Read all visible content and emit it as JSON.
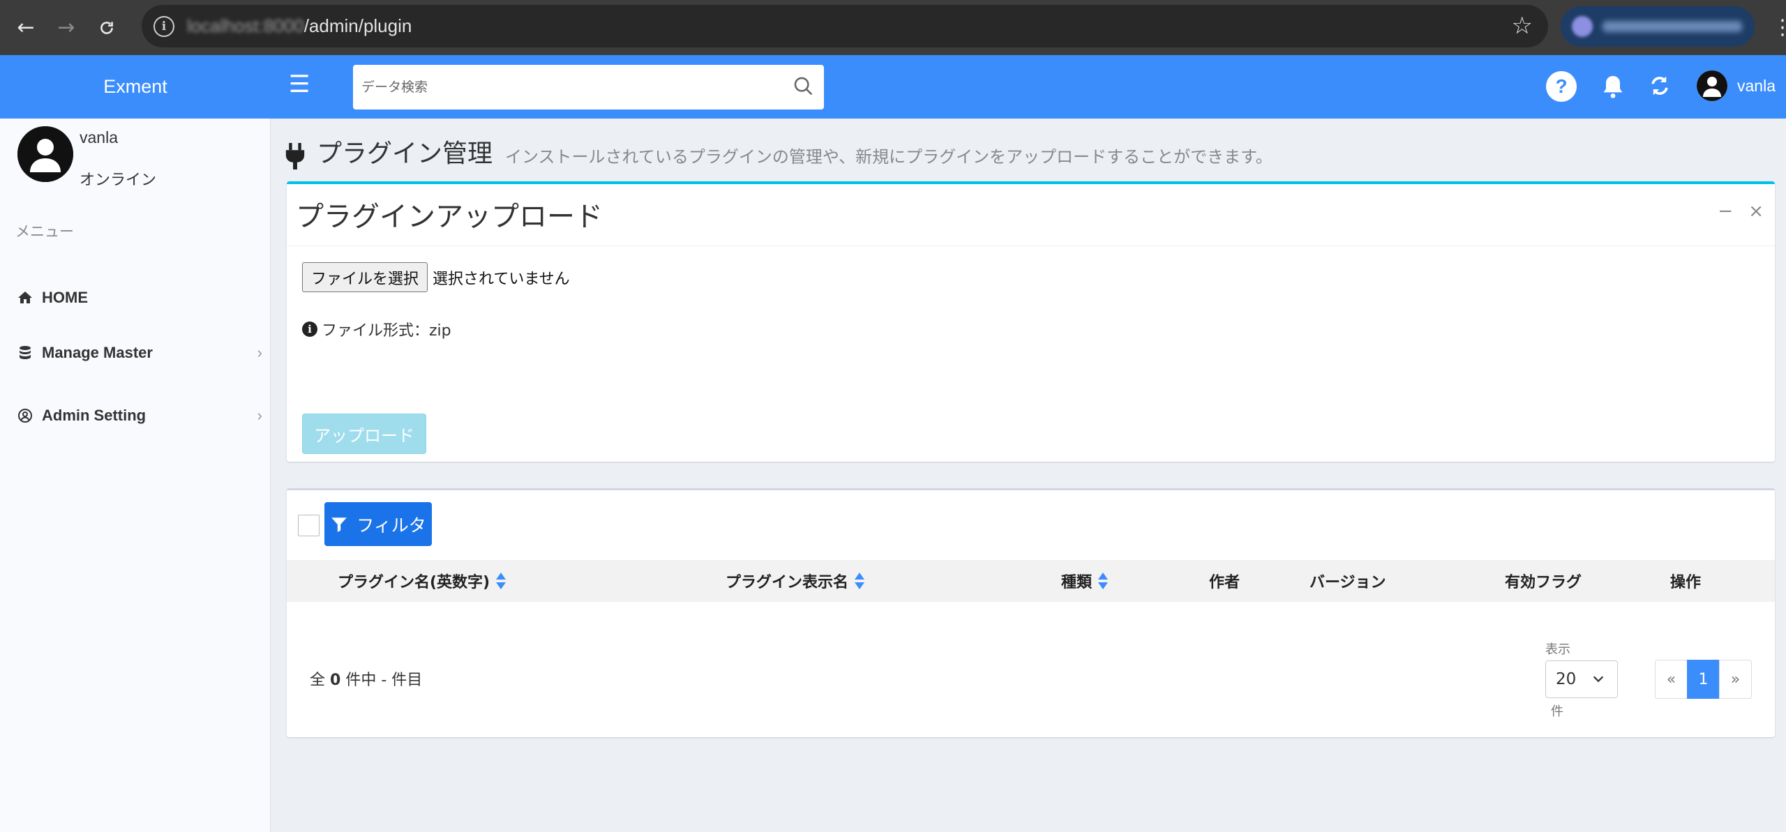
{
  "browser": {
    "url_host": "localhost:8000",
    "url_path": "/admin/plugin"
  },
  "header": {
    "logo": "Exment",
    "search_placeholder": "データ検索",
    "help_label": "?",
    "user_name": "vanla"
  },
  "sidebar": {
    "user_name": "vanla",
    "status": "オンライン",
    "menu_header": "メニュー",
    "items": [
      {
        "label": "HOME",
        "icon": "home-icon"
      },
      {
        "label": "Manage Master",
        "icon": "database-icon",
        "has_children": true
      },
      {
        "label": "Admin Setting",
        "icon": "user-circle-icon",
        "has_children": true
      }
    ]
  },
  "page": {
    "title": "プラグイン管理",
    "description": "インストールされているプラグインの管理や、新規にプラグインをアップロードすることができます。"
  },
  "upload_box": {
    "title": "プラグインアップロード",
    "file_button": "ファイルを選択",
    "file_status": "選択されていません",
    "file_help": "ファイル形式：zip",
    "upload_button": "アップロード"
  },
  "list": {
    "filter_button": "フィルタ",
    "columns": [
      {
        "label": "プラグイン名(英数字)",
        "sortable": true
      },
      {
        "label": "プラグイン表示名",
        "sortable": true
      },
      {
        "label": "種類",
        "sortable": true
      },
      {
        "label": "作者",
        "sortable": false
      },
      {
        "label": "バージョン",
        "sortable": false
      },
      {
        "label": "有効フラグ",
        "sortable": false
      },
      {
        "label": "操作",
        "sortable": false
      }
    ],
    "total_prefix": "全",
    "total_count": "0",
    "total_suffix": "件中 - 件目",
    "per_page_label": "表示",
    "per_page_value": "20",
    "per_page_unit": "件",
    "pagination": {
      "prev": "«",
      "current": "1",
      "next": "»"
    }
  },
  "colors": {
    "header_blue": "#3c8dfc",
    "box_accent": "#00c0ef",
    "filter_button": "#1a73e8",
    "upload_button_disabled": "#9fdcec"
  }
}
